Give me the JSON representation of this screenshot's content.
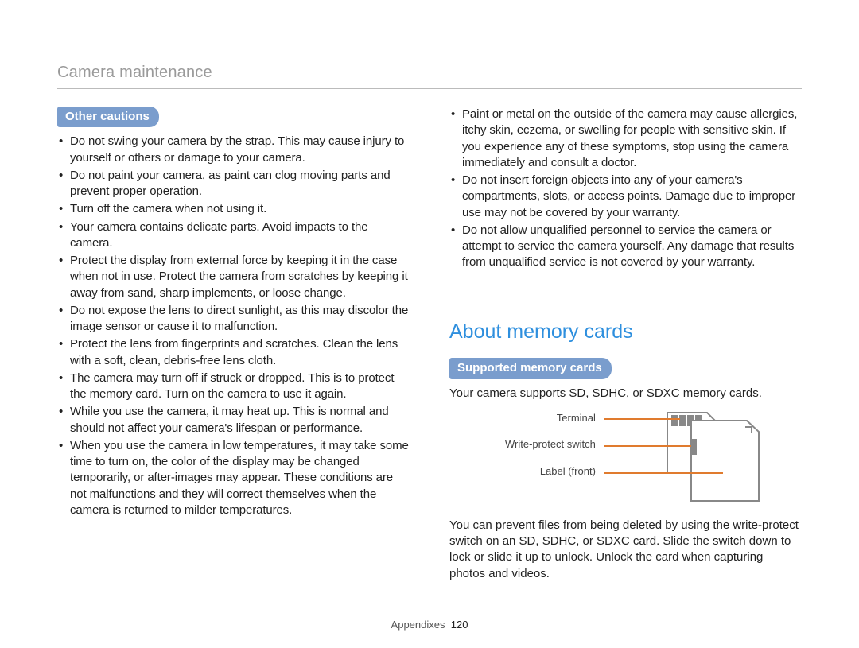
{
  "header": {
    "title": "Camera maintenance"
  },
  "left": {
    "badge": "Other cautions",
    "bullets": [
      "Do not swing your camera by the strap. This may cause injury to yourself or others or damage to your camera.",
      "Do not paint your camera, as paint can clog moving parts and prevent proper operation.",
      "Turn off the camera when not using it.",
      "Your camera contains delicate parts. Avoid impacts to the camera.",
      "Protect the display from external force by keeping it in the case when not in use. Protect the camera from scratches by keeping it away from sand, sharp implements, or loose change.",
      "Do not expose the lens to direct sunlight, as this may discolor the image sensor or cause it to malfunction.",
      "Protect the lens from fingerprints and scratches. Clean the lens with a soft, clean, debris-free lens cloth.",
      "The camera may turn off if struck or dropped. This is to protect the memory card. Turn on the camera to use it again.",
      "While you use the camera, it may heat up. This is normal and should not affect your camera's lifespan or performance.",
      "When you use the camera in low temperatures, it may take some time to turn on, the color of the display may be changed temporarily, or after-images may appear. These conditions are not malfunctions and they will correct themselves when the camera is returned to milder temperatures."
    ]
  },
  "right": {
    "top_bullets": [
      "Paint or metal on the outside of the camera may cause allergies, itchy skin, eczema, or swelling for people with sensitive skin. If you experience any of these symptoms, stop using the camera immediately and consult a doctor.",
      "Do not insert foreign objects into any of your camera's compartments, slots, or access points. Damage due to improper use may not be covered by your warranty.",
      "Do not allow unqualified personnel to service the camera or attempt to service the camera yourself. Any damage that results from unqualified service is not covered by your warranty."
    ],
    "section_heading": "About memory cards",
    "badge": "Supported memory cards",
    "intro": "Your camera supports SD, SDHC, or SDXC memory cards.",
    "diagram_labels": {
      "terminal": "Terminal",
      "write_protect": "Write-protect switch",
      "label_front": "Label (front)"
    },
    "body2": "You can prevent files from being deleted by using the write-protect switch on an SD, SDHC, or SDXC card. Slide the switch down to lock or slide it up to unlock. Unlock the card when capturing photos and videos."
  },
  "footer": {
    "section": "Appendixes",
    "page": "120"
  }
}
